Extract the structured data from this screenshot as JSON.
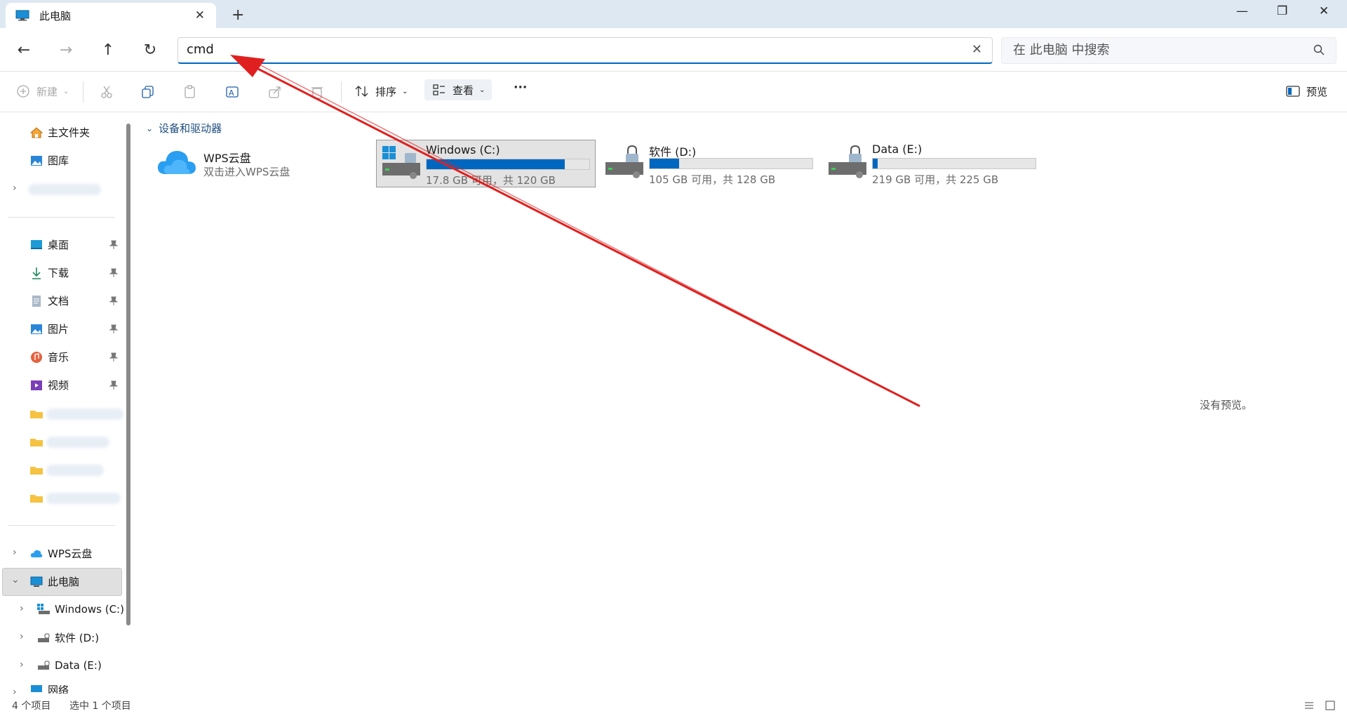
{
  "window": {
    "tab_title": "此电脑",
    "tab_close": "✕",
    "new_tab": "+",
    "minimize": "—",
    "restore": "❐",
    "close": "✕"
  },
  "nav": {
    "back": "←",
    "forward": "→",
    "up": "↑",
    "refresh": "↻",
    "address_value": "cmd",
    "address_clear": "✕",
    "search_placeholder": "在 此电脑 中搜索"
  },
  "toolbar": {
    "new_label": "新建",
    "sort_label": "排序",
    "view_label": "查看",
    "more_label": "···",
    "preview_label": "预览"
  },
  "sidebar": {
    "home": "主文件夹",
    "gallery": "图库",
    "desktop": "桌面",
    "downloads": "下载",
    "documents": "文档",
    "pictures": "图片",
    "music": "音乐",
    "videos": "视频",
    "wps_cloud": "WPS云盘",
    "this_pc": "此电脑",
    "drive_c": "Windows (C:)",
    "drive_d": "软件 (D:)",
    "drive_e": "Data (E:)",
    "network": "网络"
  },
  "content": {
    "section_title": "设备和驱动器",
    "wps_name": "WPS云盘",
    "wps_sub": "双击进入WPS云盘",
    "drives": [
      {
        "name": "Windows (C:)",
        "info": "17.8 GB 可用，共 120 GB",
        "used_fraction": 0.85
      },
      {
        "name": "软件 (D:)",
        "info": "105 GB 可用，共 128 GB",
        "used_fraction": 0.18
      },
      {
        "name": "Data (E:)",
        "info": "219 GB 可用，共 225 GB",
        "used_fraction": 0.03
      }
    ],
    "no_preview": "没有预览。"
  },
  "status": {
    "item_count": "4 个项目",
    "selected": "选中 1 个项目"
  },
  "colors": {
    "accent": "#0067c0",
    "annotation_arrow": "#e02020"
  }
}
